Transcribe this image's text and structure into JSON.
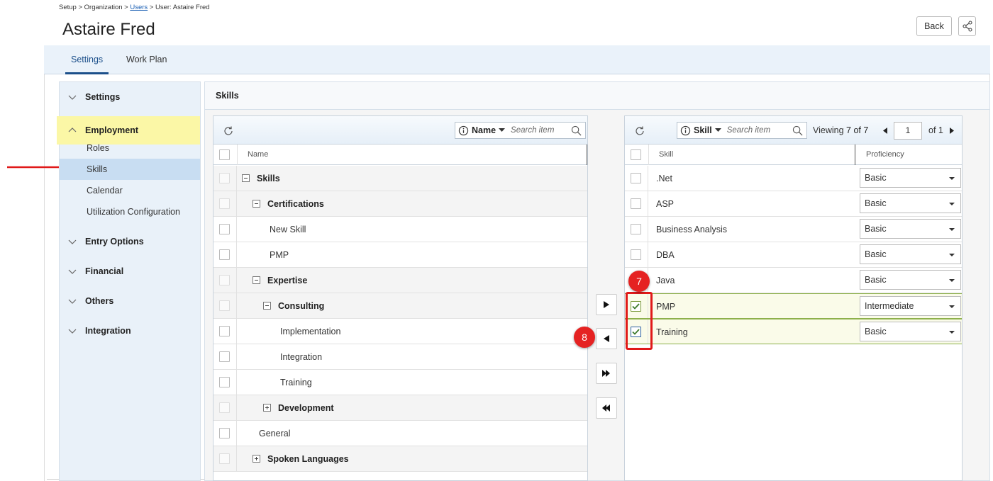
{
  "breadcrumb": {
    "setup": "Setup",
    "sep1": " > ",
    "org": "Organization",
    "sep2": " > ",
    "users": "Users",
    "sep3": " > ",
    "current": "User: Astaire Fred"
  },
  "page_title": "Astaire Fred",
  "header": {
    "back_label": "Back"
  },
  "tabs": [
    {
      "label": "Settings"
    },
    {
      "label": "Work Plan"
    }
  ],
  "sidebar": {
    "groups": {
      "settings": "Settings",
      "employment": "Employment",
      "entry_options": "Entry Options",
      "financial": "Financial",
      "others": "Others",
      "integration": "Integration"
    },
    "employment_items": [
      "Roles",
      "Skills",
      "Calendar",
      "Utilization Configuration"
    ]
  },
  "skills_panel": {
    "title": "Skills"
  },
  "left_grid": {
    "search_field": "Name",
    "search_placeholder": "Search item",
    "column_name": "Name",
    "rows": [
      {
        "label": "Skills"
      },
      {
        "label": "Certifications"
      },
      {
        "label": "New Skill"
      },
      {
        "label": "PMP"
      },
      {
        "label": "Expertise"
      },
      {
        "label": "Consulting"
      },
      {
        "label": "Implementation"
      },
      {
        "label": "Integration"
      },
      {
        "label": "Training"
      },
      {
        "label": "Development"
      },
      {
        "label": "General"
      },
      {
        "label": "Spoken Languages"
      }
    ]
  },
  "right_grid": {
    "search_field": "Skill",
    "search_placeholder": "Search item",
    "viewing_label": "Viewing",
    "viewing_count": "7 of 7",
    "page_value": "1",
    "page_of": "of 1",
    "col_skill": "Skill",
    "col_proficiency": "Proficiency",
    "rows": [
      {
        "skill": ".Net",
        "proficiency": "Basic",
        "checked": false
      },
      {
        "skill": "ASP",
        "proficiency": "Basic",
        "checked": false
      },
      {
        "skill": "Business Analysis",
        "proficiency": "Basic",
        "checked": false
      },
      {
        "skill": "DBA",
        "proficiency": "Basic",
        "checked": false
      },
      {
        "skill": "Java",
        "proficiency": "Basic",
        "checked": false
      },
      {
        "skill": "PMP",
        "proficiency": "Intermediate",
        "checked": true
      },
      {
        "skill": "Training",
        "proficiency": "Basic",
        "checked": true
      }
    ]
  },
  "annotations": {
    "badge_7": "7",
    "badge_8": "8"
  },
  "colors": {
    "accent": "#1b4f8a",
    "highlight": "#fbf7a6",
    "annotation_red": "#e52222",
    "selected_row_border": "#8db04b"
  }
}
